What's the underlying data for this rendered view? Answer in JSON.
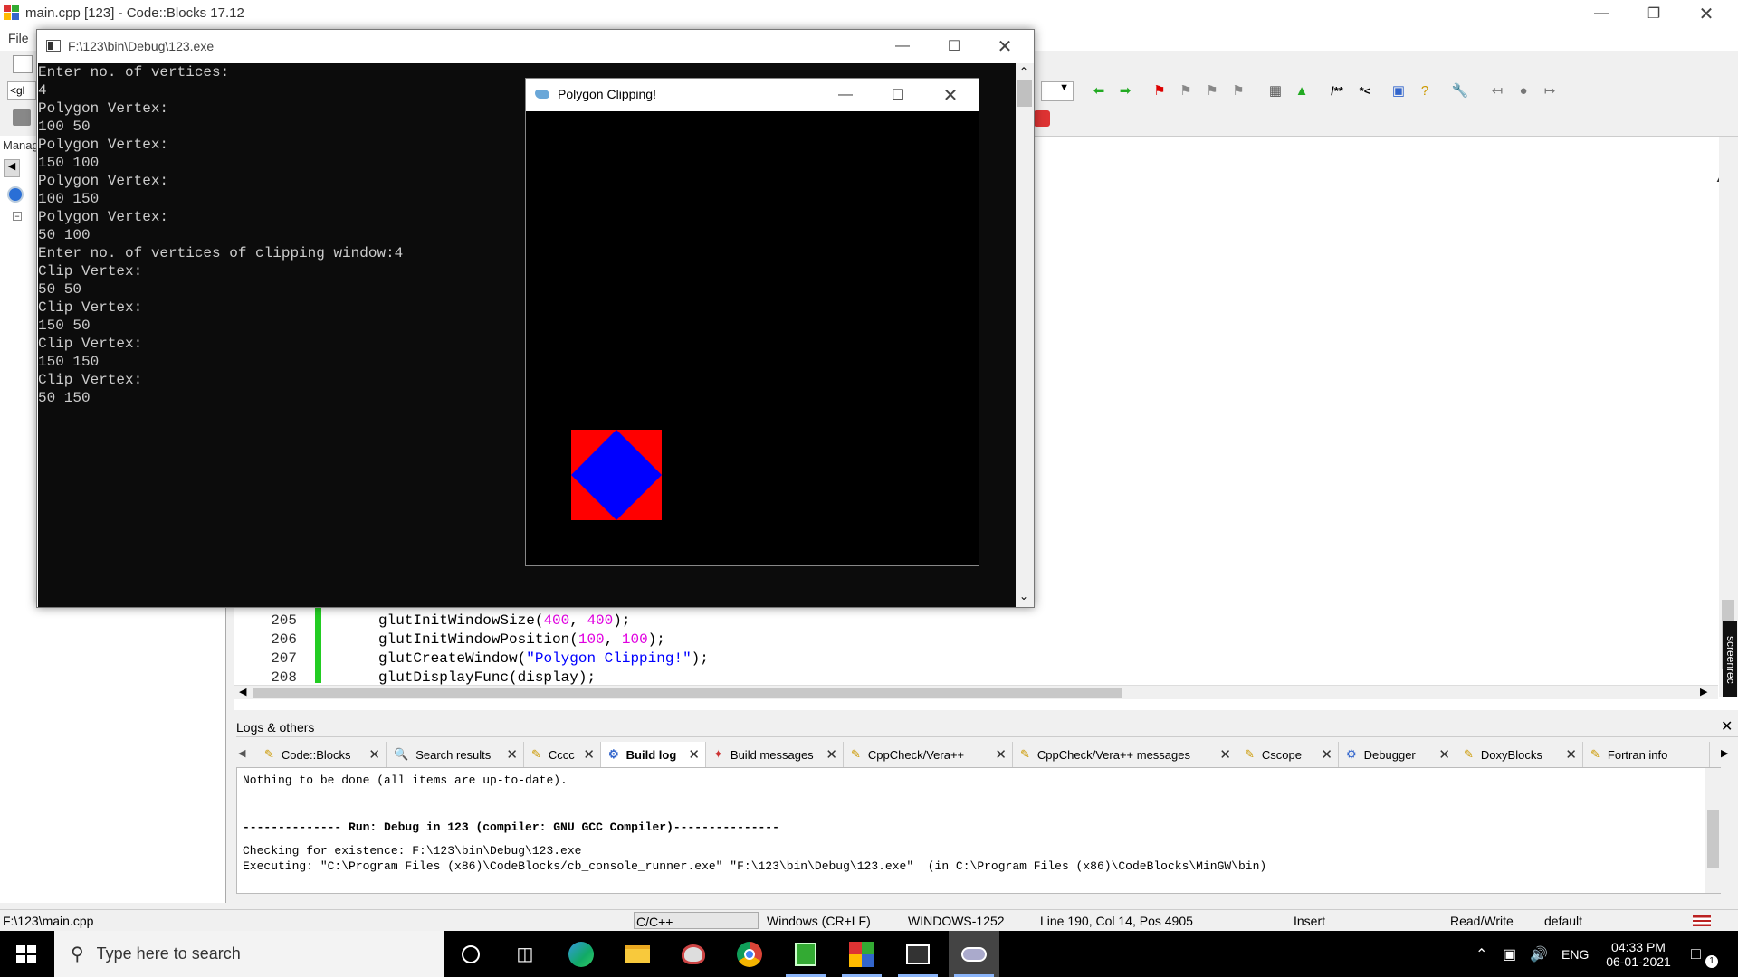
{
  "codeblocks": {
    "title": "main.cpp [123] - Code::Blocks 17.12",
    "menu_file": "File",
    "toolbar_combo": "<gl",
    "management_label": "Manag",
    "editor_lines": [
      {
        "num": "205",
        "pre": "glutInitWindowSize(",
        "a": "400",
        "mid": ", ",
        "b": "400",
        "post": ");"
      },
      {
        "num": "206",
        "pre": "glutInitWindowPosition(",
        "a": "100",
        "mid": ", ",
        "b": "100",
        "post": ");"
      },
      {
        "num": "207",
        "pre": "glutCreateWindow(",
        "s": "\"Polygon Clipping!\"",
        "post": ");"
      },
      {
        "num": "208",
        "pre": "glutDisplayFunc(display);"
      }
    ],
    "side_label": "screenrec"
  },
  "logs": {
    "title": "Logs & others",
    "tabs": [
      "Code::Blocks",
      "Search results",
      "Cccc",
      "Build log",
      "Build messages",
      "CppCheck/Vera++",
      "CppCheck/Vera++ messages",
      "Cscope",
      "Debugger",
      "DoxyBlocks",
      "Fortran info"
    ],
    "lines": [
      "Nothing to be done (all items are up-to-date).",
      "",
      "",
      "-------------- Run: Debug in 123 (compiler: GNU GCC Compiler)---------------",
      "",
      "Checking for existence: F:\\123\\bin\\Debug\\123.exe",
      "Executing: \"C:\\Program Files (x86)\\CodeBlocks/cb_console_runner.exe\" \"F:\\123\\bin\\Debug\\123.exe\"  (in C:\\Program Files (x86)\\CodeBlocks\\MinGW\\bin)"
    ]
  },
  "status": {
    "file": "F:\\123\\main.cpp",
    "lang": "C/C++",
    "eol": "Windows (CR+LF)",
    "encoding": "WINDOWS-1252",
    "position": "Line 190, Col 14, Pos 4905",
    "mode": "Insert",
    "access": "Read/Write",
    "profile": "default"
  },
  "console": {
    "title": "F:\\123\\bin\\Debug\\123.exe",
    "lines": [
      "Enter no. of vertices:",
      "4",
      "Polygon Vertex:",
      "100 50",
      "Polygon Vertex:",
      "150 100",
      "Polygon Vertex:",
      "100 150",
      "Polygon Vertex:",
      "50 100",
      "Enter no. of vertices of clipping window:4",
      "Clip Vertex:",
      "50 50",
      "Clip Vertex:",
      "150 50",
      "Clip Vertex:",
      "150 150",
      "Clip Vertex:",
      "50 150"
    ]
  },
  "glut": {
    "title": "Polygon Clipping!",
    "clip_color": "#ff0000",
    "polygon_color": "#0000ff"
  },
  "taskbar": {
    "search_placeholder": "Type here to search",
    "lang": "ENG",
    "time": "04:33 PM",
    "date": "06-01-2021",
    "notification_count": "1"
  }
}
